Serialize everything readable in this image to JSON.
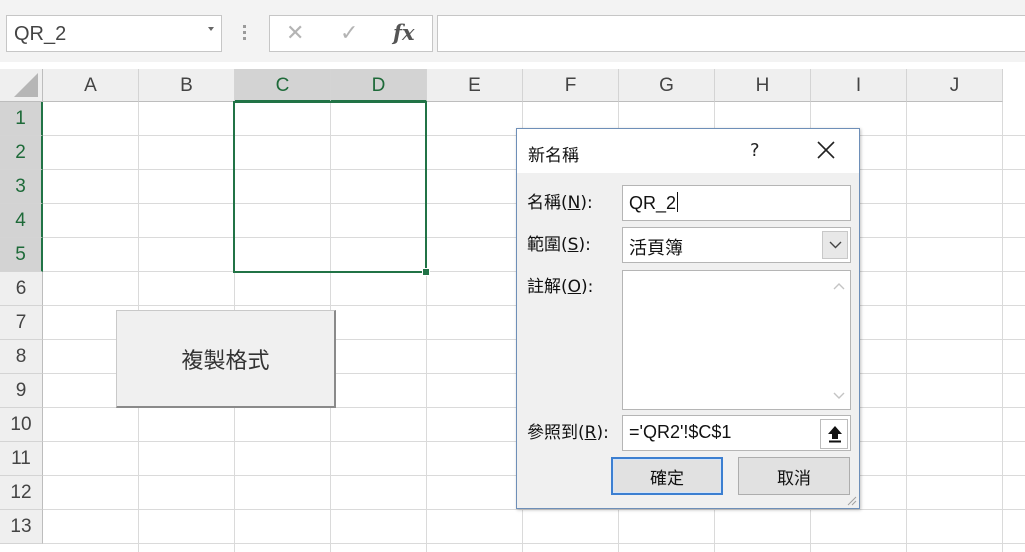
{
  "formula_bar": {
    "name_box": "QR_2",
    "cancel_glyph": "✕",
    "enter_glyph": "✓",
    "fx_label": "fx",
    "formula_value": ""
  },
  "sheet": {
    "columns": [
      "A",
      "B",
      "C",
      "D",
      "E",
      "F",
      "G",
      "H",
      "I",
      "J"
    ],
    "rows": [
      "1",
      "2",
      "3",
      "4",
      "5",
      "6",
      "7",
      "8",
      "9",
      "10",
      "11",
      "12",
      "13"
    ],
    "selected_columns": [
      "C",
      "D"
    ],
    "selected_rows": [
      "1",
      "2",
      "3",
      "4",
      "5"
    ],
    "selection_color": "#217346",
    "form_button_label": "複製格式"
  },
  "dialog": {
    "title": "新名稱",
    "help_glyph": "?",
    "name_label": {
      "pre": "名稱(",
      "key": "N",
      "post": "):"
    },
    "name_value": "QR_2",
    "scope_label": {
      "pre": "範圍(",
      "key": "S",
      "post": "):"
    },
    "scope_value": "活頁簿",
    "comment_label": {
      "pre": "註解(",
      "key": "O",
      "post": "):"
    },
    "comment_value": "",
    "refers_label": {
      "pre": "參照到(",
      "key": "R",
      "post": "):"
    },
    "refers_value": "='QR2'!$C$1",
    "ok_label": "確定",
    "cancel_label": "取消",
    "accent_color": "#3c7fd1"
  }
}
